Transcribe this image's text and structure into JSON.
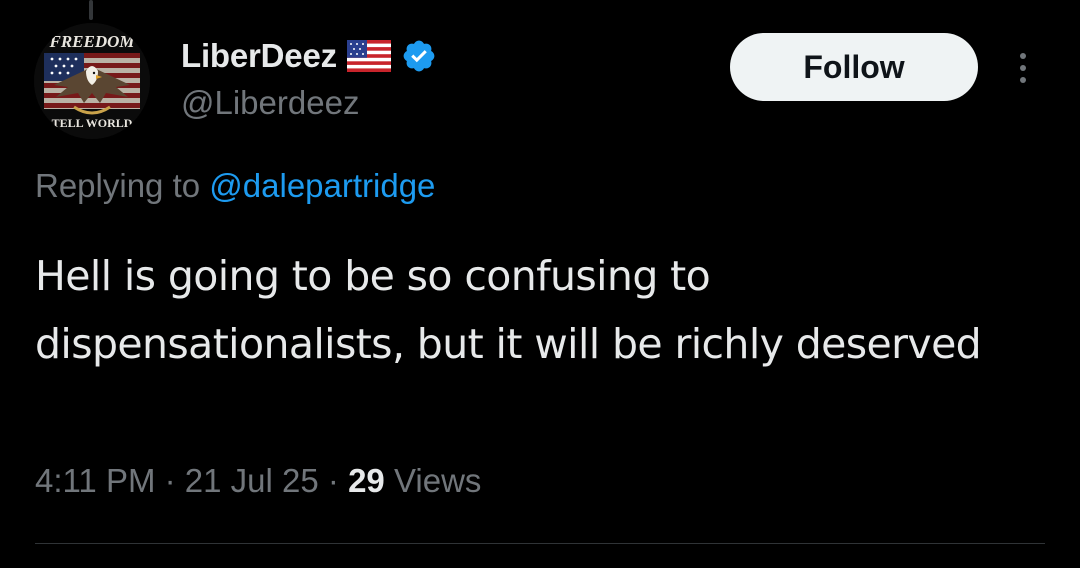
{
  "tweet": {
    "author": {
      "display_name": "LiberDeez",
      "handle": "@Liberdeez",
      "flag_icon": "us-flag-emoji",
      "verified_icon": "verified-badge-icon",
      "avatar_text_top": "FREEDOM",
      "avatar_text_bottom": "TELL WORLD"
    },
    "follow_label": "Follow",
    "more_icon": "more-vertical-icon",
    "replying_to_label": "Replying to",
    "replying_to_handle": "@dalepartridge",
    "text": "Hell is going to be so confusing to dispensationalists, but it will be richly deserved",
    "time": "4:11 PM",
    "date": "21 Jul 25",
    "separator": "·",
    "views_count": "29",
    "views_label": "Views"
  },
  "colors": {
    "background": "#000000",
    "text_primary": "#e7e9ea",
    "text_secondary": "#71767b",
    "link": "#1d9bf0",
    "verified": "#1d9bf0",
    "follow_bg": "#eff3f4",
    "divider": "#2f3336"
  }
}
